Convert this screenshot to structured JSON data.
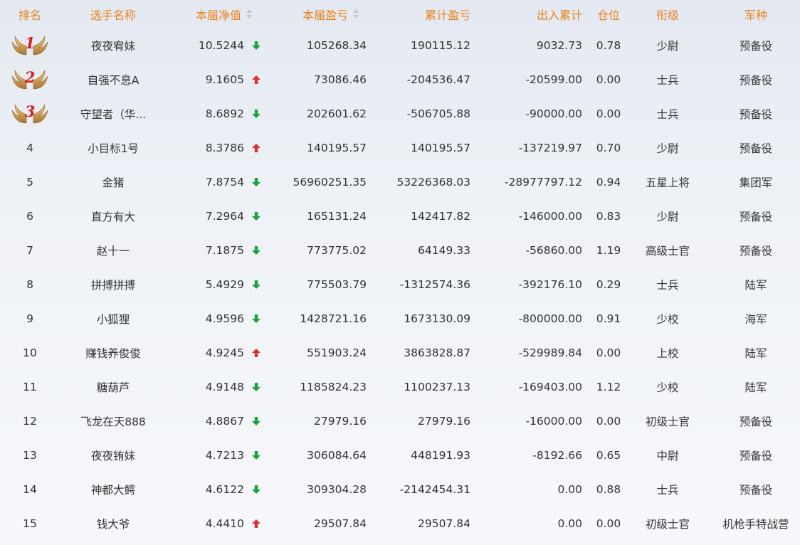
{
  "colors": {
    "header_text": "#e8821e",
    "arrow_up": "#e02d2d",
    "arrow_down": "#1aa23a",
    "medal_number": "#d81e1e"
  },
  "headers": {
    "rank": "排名",
    "name": "选手名称",
    "nav": "本届净值",
    "profit": "本届盈亏",
    "cumulative": "累计盈亏",
    "flow": "出入累计",
    "position": "仓位",
    "military_rank": "衔级",
    "army": "军种"
  },
  "rows": [
    {
      "rank": "1",
      "medal": true,
      "name": "夜夜宥妹",
      "nav": "10.5244",
      "trend": "down",
      "profit": "105268.34",
      "cumulative": "190115.12",
      "flow": "9032.73",
      "position": "0.78",
      "military_rank": "少尉",
      "army": "预备役"
    },
    {
      "rank": "2",
      "medal": true,
      "name": "自强不息A",
      "nav": "9.1605",
      "trend": "up",
      "profit": "73086.46",
      "cumulative": "-204536.47",
      "flow": "-20599.00",
      "position": "0.00",
      "military_rank": "士兵",
      "army": "预备役"
    },
    {
      "rank": "3",
      "medal": true,
      "name": "守望者（华...",
      "nav": "8.6892",
      "trend": "down",
      "profit": "202601.62",
      "cumulative": "-506705.88",
      "flow": "-90000.00",
      "position": "0.00",
      "military_rank": "士兵",
      "army": "预备役"
    },
    {
      "rank": "4",
      "medal": false,
      "name": "小目标1号",
      "nav": "8.3786",
      "trend": "up",
      "profit": "140195.57",
      "cumulative": "140195.57",
      "flow": "-137219.97",
      "position": "0.70",
      "military_rank": "少尉",
      "army": "预备役"
    },
    {
      "rank": "5",
      "medal": false,
      "name": "金猪",
      "nav": "7.8754",
      "trend": "down",
      "profit": "56960251.35",
      "cumulative": "53226368.03",
      "flow": "-28977797.12",
      "position": "0.94",
      "military_rank": "五星上将",
      "army": "集团军"
    },
    {
      "rank": "6",
      "medal": false,
      "name": "直方有大",
      "nav": "7.2964",
      "trend": "down",
      "profit": "165131.24",
      "cumulative": "142417.82",
      "flow": "-146000.00",
      "position": "0.83",
      "military_rank": "少尉",
      "army": "预备役"
    },
    {
      "rank": "7",
      "medal": false,
      "name": "赵十一",
      "nav": "7.1875",
      "trend": "down",
      "profit": "773775.02",
      "cumulative": "64149.33",
      "flow": "-56860.00",
      "position": "1.19",
      "military_rank": "高级士官",
      "army": "预备役"
    },
    {
      "rank": "8",
      "medal": false,
      "name": "拼搏拼搏",
      "nav": "5.4929",
      "trend": "down",
      "profit": "775503.79",
      "cumulative": "-1312574.36",
      "flow": "-392176.10",
      "position": "0.29",
      "military_rank": "士兵",
      "army": "陆军"
    },
    {
      "rank": "9",
      "medal": false,
      "name": "小狐狸",
      "nav": "4.9596",
      "trend": "down",
      "profit": "1428721.16",
      "cumulative": "1673130.09",
      "flow": "-800000.00",
      "position": "0.91",
      "military_rank": "少校",
      "army": "海军"
    },
    {
      "rank": "10",
      "medal": false,
      "name": "赚钱养俊俊",
      "nav": "4.9245",
      "trend": "up",
      "profit": "551903.24",
      "cumulative": "3863828.87",
      "flow": "-529989.84",
      "position": "0.00",
      "military_rank": "上校",
      "army": "陆军"
    },
    {
      "rank": "11",
      "medal": false,
      "name": "糖葫芦",
      "nav": "4.9148",
      "trend": "down",
      "profit": "1185824.23",
      "cumulative": "1100237.13",
      "flow": "-169403.00",
      "position": "1.12",
      "military_rank": "少校",
      "army": "陆军"
    },
    {
      "rank": "12",
      "medal": false,
      "name": "飞龙在天888",
      "nav": "4.8867",
      "trend": "down",
      "profit": "27979.16",
      "cumulative": "27979.16",
      "flow": "-16000.00",
      "position": "0.00",
      "military_rank": "初级士官",
      "army": "预备役"
    },
    {
      "rank": "13",
      "medal": false,
      "name": "夜夜铕妹",
      "nav": "4.7213",
      "trend": "down",
      "profit": "306084.64",
      "cumulative": "448191.93",
      "flow": "-8192.66",
      "position": "0.65",
      "military_rank": "中尉",
      "army": "预备役"
    },
    {
      "rank": "14",
      "medal": false,
      "name": "神都大鳄",
      "nav": "4.6122",
      "trend": "down",
      "profit": "309304.28",
      "cumulative": "-2142454.31",
      "flow": "0.00",
      "position": "0.88",
      "military_rank": "士兵",
      "army": "预备役"
    },
    {
      "rank": "15",
      "medal": false,
      "name": "钱大爷",
      "nav": "4.4410",
      "trend": "up",
      "profit": "29507.84",
      "cumulative": "29507.84",
      "flow": "0.00",
      "position": "0.00",
      "military_rank": "初级士官",
      "army": "机枪手特战营"
    }
  ]
}
